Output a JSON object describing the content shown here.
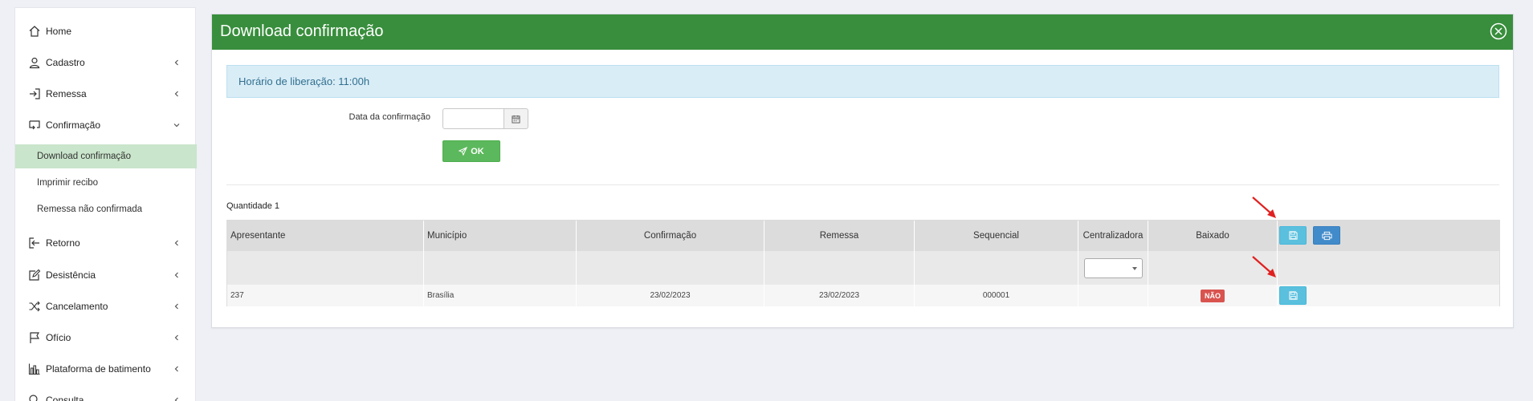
{
  "sidebar": {
    "items": [
      {
        "label": "Home",
        "icon": "home-icon",
        "chevron": false
      },
      {
        "label": "Cadastro",
        "icon": "user-icon",
        "chevron": true
      },
      {
        "label": "Remessa",
        "icon": "sign-in-icon",
        "chevron": true
      },
      {
        "label": "Confirmação",
        "icon": "monitor-return-icon",
        "chevron": "down"
      },
      {
        "label": "Retorno",
        "icon": "sign-out-icon",
        "chevron": true
      },
      {
        "label": "Desistência",
        "icon": "edit-icon",
        "chevron": true
      },
      {
        "label": "Cancelamento",
        "icon": "shuffle-icon",
        "chevron": true
      },
      {
        "label": "Ofício",
        "icon": "flag-icon",
        "chevron": true
      },
      {
        "label": "Plataforma de batimento",
        "icon": "bar-chart-icon",
        "chevron": true
      },
      {
        "label": "Consulta",
        "icon": "search-icon",
        "chevron": true
      }
    ],
    "sub_items": [
      {
        "label": "Download confirmação",
        "active": true
      },
      {
        "label": "Imprimir recibo",
        "active": false
      },
      {
        "label": "Remessa não confirmada",
        "active": false
      }
    ]
  },
  "panel": {
    "title": "Download confirmação",
    "alert": "Horário de liberação:  11:00h",
    "date_label": "Data da confirmação",
    "date_value": "",
    "ok_label": "OK",
    "quantity": "Quantidade 1"
  },
  "table": {
    "columns": [
      "Apresentante",
      "Município",
      "Confirmação",
      "Remessa",
      "Sequencial",
      "Centralizadora",
      "Baixado"
    ],
    "rows": [
      {
        "apresentante": "237",
        "municipio": "Brasília",
        "confirmacao": "23/02/2023",
        "remessa": "23/02/2023",
        "sequencial": "000001",
        "centralizadora": "",
        "baixado": "NÃO"
      }
    ],
    "centralizadora_filter": ""
  },
  "colors": {
    "header_green": "#388e3c",
    "ok_green": "#5cb85c",
    "active_sub_bg": "#c9e5cb",
    "alert_bg": "#d9edf7",
    "badge_red": "#d9534f",
    "btn_info": "#5bc0de",
    "btn_primary": "#428bca",
    "annotation_arrow": "#e02020"
  }
}
